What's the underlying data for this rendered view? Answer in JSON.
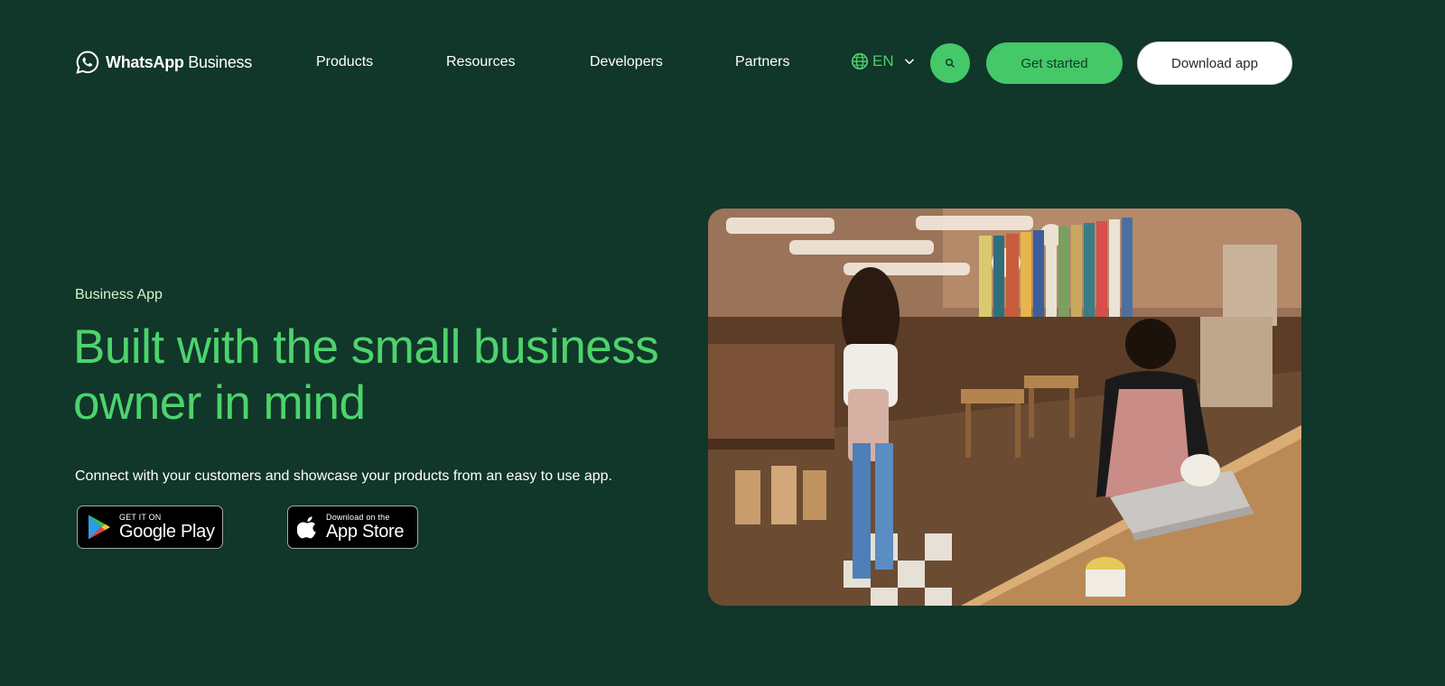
{
  "header": {
    "logo": {
      "brand": "WhatsApp",
      "suffix": " Business",
      "icon": "whatsapp-logo-icon"
    },
    "nav": [
      "Products",
      "Resources",
      "Developers",
      "Partners"
    ],
    "language": {
      "label": "EN",
      "icon": "globe-icon",
      "chevron_icon": "chevron-down-icon"
    },
    "search_icon": "search-icon",
    "get_started": "Get started",
    "download_app": "Download app"
  },
  "hero": {
    "eyebrow": "Business App",
    "headline": "Built with the small business owner in mind",
    "description": "Connect with your customers and showcase your products from an easy to use app.",
    "google_play": {
      "small": "GET IT ON",
      "big": "Google Play",
      "icon": "google-play-icon"
    },
    "app_store": {
      "small": "Download on the",
      "big": "App Store",
      "icon": "apple-icon"
    },
    "photo_icon": "shop-photo"
  },
  "colors": {
    "background": "#11362a",
    "accent": "#44c868",
    "headline": "#4dd36c",
    "eyebrow": "#d6f5c8"
  }
}
